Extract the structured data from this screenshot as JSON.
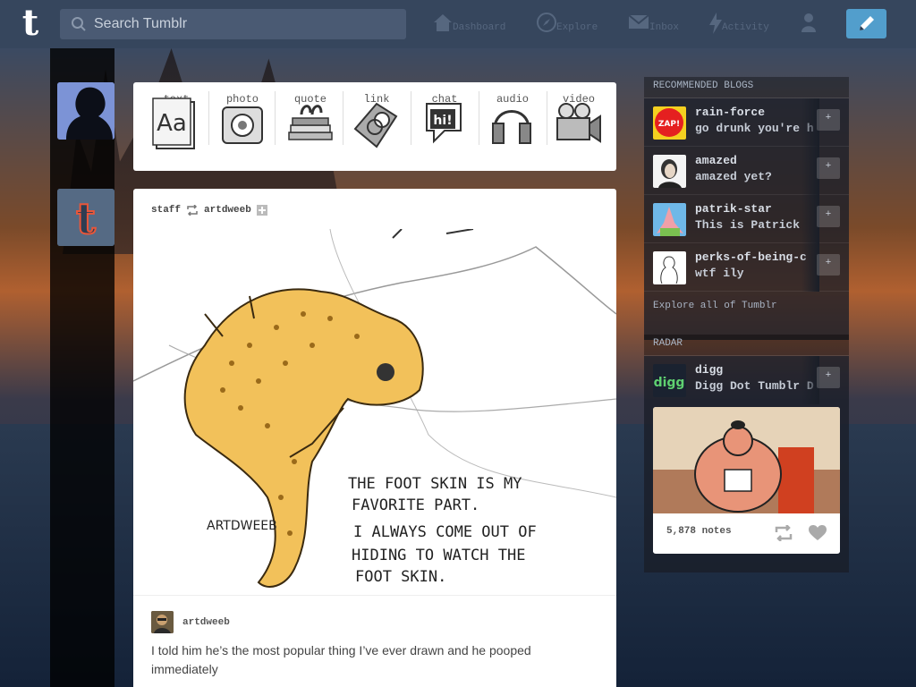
{
  "header": {
    "search_placeholder": "Search Tumblr",
    "nav": [
      {
        "label": "Dashboard"
      },
      {
        "label": "Explore"
      },
      {
        "label": "Inbox"
      },
      {
        "label": "Activity"
      }
    ]
  },
  "post_types": [
    {
      "label": "text"
    },
    {
      "label": "photo"
    },
    {
      "label": "quote"
    },
    {
      "label": "link"
    },
    {
      "label": "chat"
    },
    {
      "label": "audio"
    },
    {
      "label": "video"
    }
  ],
  "post": {
    "reblogger": "staff",
    "source": "artdweeb",
    "author": "artdweeb",
    "caption": "I told him he’s the most popular thing I’ve ever drawn and he pooped immediately",
    "image_text": {
      "line1": "THE FOOT SKIN IS MY",
      "line2": "FAVORITE PART.",
      "line3": "I ALWAYS COME OUT OF",
      "line4": "HIDING TO WATCH THE",
      "line5": "FOOT SKIN.",
      "signature": "ARTDWEEB"
    }
  },
  "sidebar": {
    "recommended_title": "RECOMMENDED BLOGS",
    "blogs": [
      {
        "name": "rain-force",
        "desc": "go drunk you're h"
      },
      {
        "name": "amazed",
        "desc": "amazed yet?"
      },
      {
        "name": "patrik-star",
        "desc": "This is Patrick"
      },
      {
        "name": "perks-of-being-c",
        "desc": "wtf ily"
      }
    ],
    "explore_link": "Explore all of Tumblr",
    "radar_title": "RADAR",
    "radar_blog": {
      "name": "digg",
      "desc": "Digg Dot Tumblr D"
    },
    "radar_notes": "5,878 notes"
  },
  "colors": {
    "header_bg": "#36465d",
    "compose_bg": "#529ecc"
  }
}
